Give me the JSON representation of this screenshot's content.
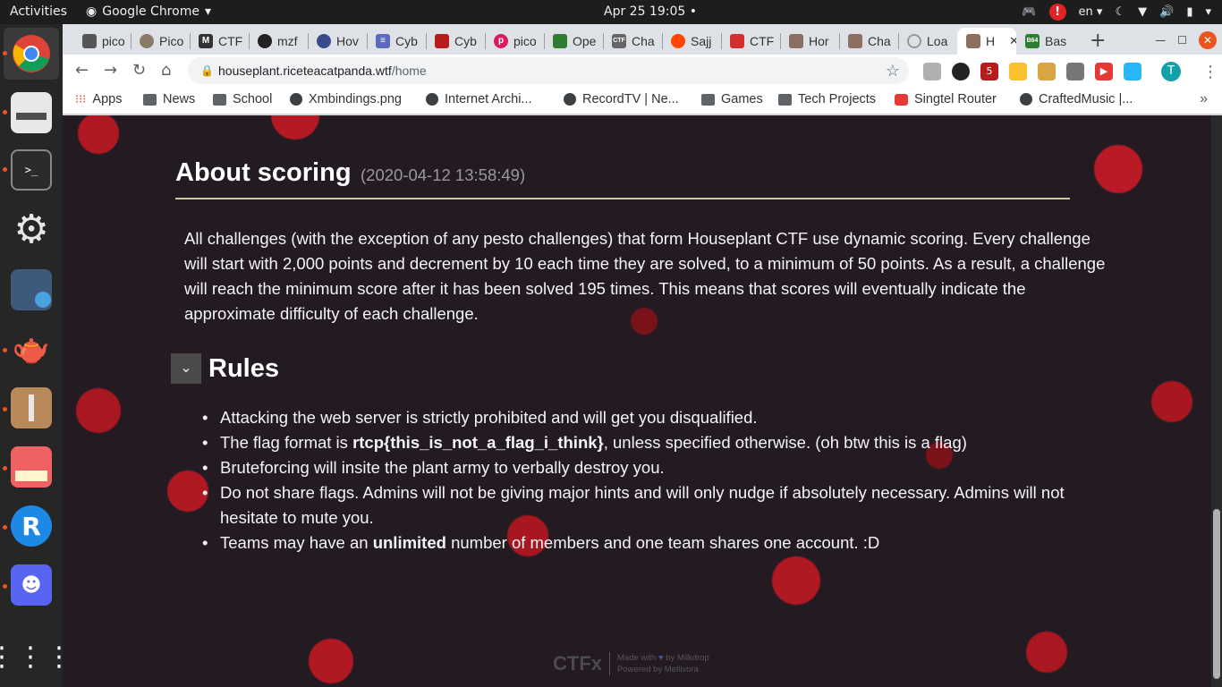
{
  "topbar": {
    "activities": "Activities",
    "app_name": "Google Chrome",
    "clock": "Apr 25  19:05",
    "language": "en"
  },
  "tabs": [
    {
      "label": "pico",
      "favicon_color": "#555555"
    },
    {
      "label": "Pico",
      "favicon_color": "#8a7a6a"
    },
    {
      "label": "CTF",
      "favicon_color": "#333333"
    },
    {
      "label": "mzf",
      "favicon_color": "#222222"
    },
    {
      "label": "Hov",
      "favicon_color": "#3b4a8a"
    },
    {
      "label": "Cyb",
      "favicon_color": "#5c6bc0"
    },
    {
      "label": "Cyb",
      "favicon_color": "#b71c1c"
    },
    {
      "label": "pico",
      "favicon_color": "#d81b60"
    },
    {
      "label": "Ope",
      "favicon_color": "#2e7d32"
    },
    {
      "label": "Cha",
      "favicon_color": "#666666"
    },
    {
      "label": "Sajj",
      "favicon_color": "#ff4500"
    },
    {
      "label": "CTF",
      "favicon_color": "#d32f2f"
    },
    {
      "label": "Hor",
      "favicon_color": "#8d6e63"
    },
    {
      "label": "Cha",
      "favicon_color": "#8d6e63"
    },
    {
      "label": "Loa",
      "favicon_color": "#999999"
    },
    {
      "label": "H",
      "favicon_color": "#8d6e63"
    },
    {
      "label": "Bas",
      "favicon_color": "#2e7d32"
    }
  ],
  "omnibox": {
    "host": "houseplant.riceteacatpanda.wtf",
    "path": "/home"
  },
  "profile_initial": "T",
  "bookmarks": [
    {
      "label": "Apps",
      "icon": "apps-grid-icon"
    },
    {
      "label": "News",
      "icon": "folder-icon"
    },
    {
      "label": "School",
      "icon": "folder-icon"
    },
    {
      "label": "Xmbindings.png",
      "icon": "globe-icon"
    },
    {
      "label": "Internet Archi...",
      "icon": "globe-icon"
    },
    {
      "label": "RecordTV | Ne...",
      "icon": "globe-icon"
    },
    {
      "label": "Games",
      "icon": "folder-icon"
    },
    {
      "label": "Tech Projects",
      "icon": "folder-icon"
    },
    {
      "label": "Singtel Router",
      "icon": "singtel-icon"
    },
    {
      "label": "CraftedMusic |...",
      "icon": "globe-icon"
    }
  ],
  "content": {
    "scoring_title": "About scoring",
    "scoring_date": "(2020-04-12 13:58:49)",
    "scoring_text": "All challenges (with the exception of any pesto challenges) that form Houseplant CTF use dynamic scoring. Every challenge will start with 2,000 points and decrement by 10 each time they are solved, to a minimum of 50 points. As a result, a challenge will reach the minimum score after it has been solved 195 times. This means that scores will eventually indicate the approximate difficulty of each challenge.",
    "rules_title": "Rules",
    "rules": {
      "r1": "Attacking the web server is strictly prohibited and will get you disqualified.",
      "r2_pre": "The flag format is ",
      "r2_bold": "rtcp{this_is_not_a_flag_i_think}",
      "r2_post": ", unless specified otherwise. (oh btw this is a flag)",
      "r3": "Bruteforcing will insite the plant army to verbally destroy you.",
      "r4": "Do not share flags. Admins will not be giving major hints and will only nudge if absolutely necessary. Admins will not hesitate to mute you.",
      "r5_pre": "Teams may have an ",
      "r5_bold": "unlimited",
      "r5_post": " number of members and one team shares one account. :D"
    }
  },
  "footer": {
    "logo": "CTFx",
    "made_with": "Made with",
    "made_by": "by Milkdrop",
    "powered_by": "Powered by Mellivora"
  },
  "colors": {
    "accent": "#e95420",
    "page_background": "#241a22",
    "flower_red": "#b01822"
  }
}
